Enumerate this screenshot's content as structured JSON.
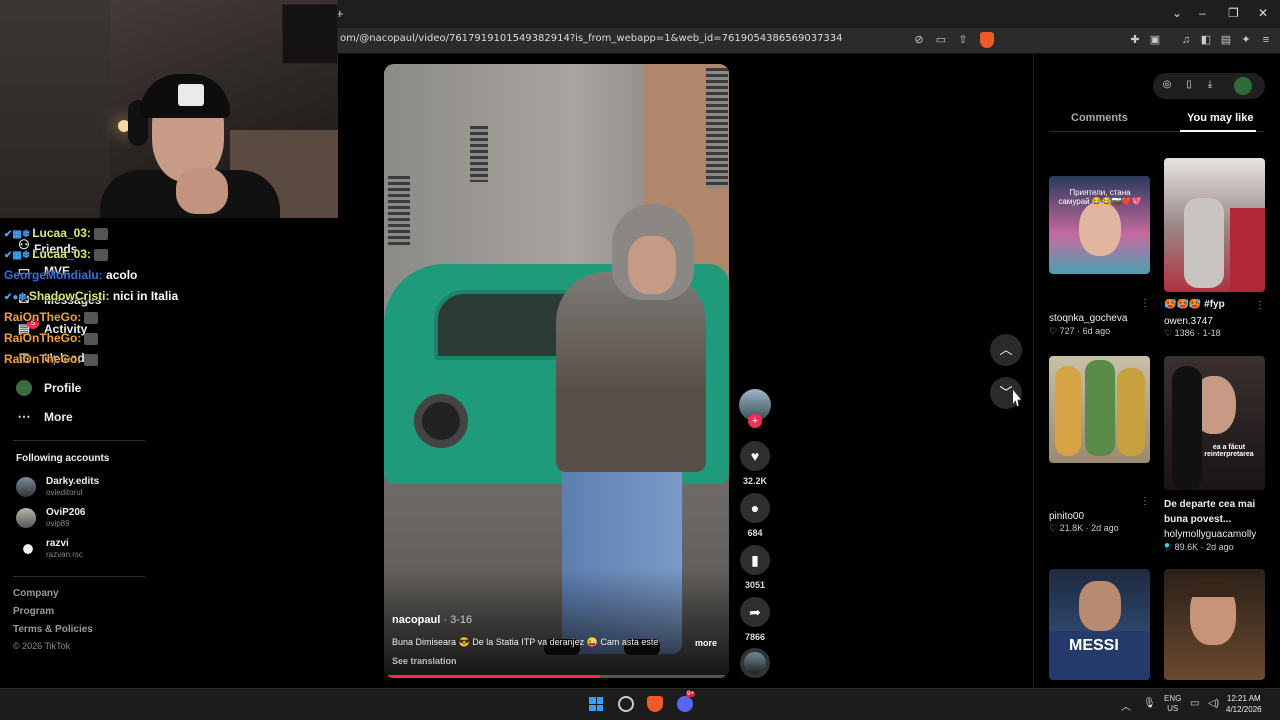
{
  "browser": {
    "new_tab": "+",
    "url": "om/@nacopaul/video/7617919101549382914?is_from_webapp=1&web_id=7619054386569037334",
    "window_controls": [
      "⌄",
      "–",
      "❐",
      "✕"
    ]
  },
  "left_nav": {
    "items": [
      {
        "label": "Friends",
        "icon": "friends-icon"
      },
      {
        "label": "MVE",
        "icon": "tv-icon"
      },
      {
        "label": "Messages",
        "icon": "message-icon"
      },
      {
        "label": "Activity",
        "icon": "activity-icon",
        "badge": "5"
      },
      {
        "label": "Upload",
        "icon": "upload-icon"
      },
      {
        "label": "Profile",
        "icon": "profile-icon"
      },
      {
        "label": "More",
        "icon": "more-icon"
      }
    ],
    "following_header": "Following accounts",
    "accounts": [
      {
        "name": "Darky.edits",
        "handle": "ovieditorul"
      },
      {
        "name": "OviP206",
        "handle": "ovip89"
      },
      {
        "name": "razvi",
        "handle": "razvan.rsc"
      }
    ],
    "footer": [
      "Company",
      "Program",
      "Terms & Policies"
    ],
    "copyright": "© 2026 TikTok"
  },
  "chat": [
    {
      "user": "Lucaa_03:",
      "msg": "",
      "color": "#d8ec74"
    },
    {
      "user": "Lucaa_03:",
      "msg": "",
      "color": "#d8ec74"
    },
    {
      "user": "GeorgeMondialu:",
      "msg": "acolo",
      "color": "#3a6fe0"
    },
    {
      "user": "ShadowCristi:",
      "msg": "nici in Italia",
      "color": "#d8ec74"
    },
    {
      "user": "RaiOnTheGo:",
      "msg": "",
      "color": "#f0a23a"
    },
    {
      "user": "RaiOnTheGo:",
      "msg": "",
      "color": "#f0a23a"
    },
    {
      "user": "RaiOnTheGo:",
      "msg": "",
      "color": "#f0a23a"
    }
  ],
  "video": {
    "author": "nacopaul",
    "date": " · 3-16",
    "caption": "Buna Dimiseara 😎 De la Statia ITP va deranjez 😜 Cam asta este",
    "more": "more",
    "see_translation": "See translation",
    "progress": 0.63
  },
  "actions": {
    "likes": "32.2K",
    "comments": "684",
    "saves": "3051",
    "shares": "7866"
  },
  "right_panel": {
    "tab_comments": "Comments",
    "tab_you_may_like": "You may like",
    "videos": [
      {
        "overlay": "Приятели, стана самурай 😂😂🇧🇬❤️💖",
        "title": "",
        "author": "stoqnka_gocheva",
        "likes": "727",
        "date": "6d ago"
      },
      {
        "overlay": "",
        "title": "🥵🥵🥵 #fyp",
        "author": "owen.3747",
        "likes": "1386",
        "date": "1-18"
      },
      {
        "overlay": "",
        "title": "",
        "author": "pinito00",
        "likes": "21.8K",
        "date": "2d ago"
      },
      {
        "overlay": "ea a făcut reinterpretarea",
        "title": "De departe cea mai buna povest...",
        "author": "holymollyguacamolly",
        "likes": "89.6K",
        "date": "2d ago"
      },
      {
        "overlay": "MESSI",
        "title": "",
        "author": "",
        "likes": "",
        "date": ""
      },
      {
        "overlay": "",
        "title": "",
        "author": "",
        "likes": "",
        "date": ""
      }
    ]
  },
  "taskbar": {
    "lang_top": "ENG",
    "lang_bottom": "US",
    "time": "12:21 AM",
    "date": "4/12/2026",
    "discord_badge": "9+"
  }
}
